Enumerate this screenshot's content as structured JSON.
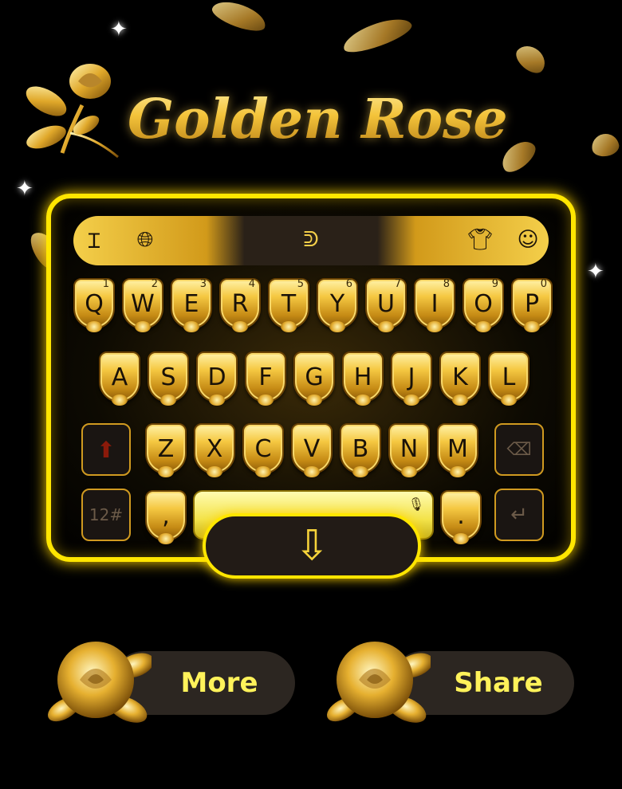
{
  "title": "Golden Rose",
  "toolbar": {
    "icons": [
      "text-cursor-icon",
      "globe-icon",
      "touchpal-logo-icon",
      "shirt-icon",
      "emoji-icon"
    ]
  },
  "keyboard": {
    "row1": [
      {
        "label": "Q",
        "num": "1"
      },
      {
        "label": "W",
        "num": "2"
      },
      {
        "label": "E",
        "num": "3"
      },
      {
        "label": "R",
        "num": "4"
      },
      {
        "label": "T",
        "num": "5"
      },
      {
        "label": "Y",
        "num": "6"
      },
      {
        "label": "U",
        "num": "7"
      },
      {
        "label": "I",
        "num": "8"
      },
      {
        "label": "O",
        "num": "9"
      },
      {
        "label": "P",
        "num": "0"
      }
    ],
    "row2": [
      "A",
      "S",
      "D",
      "F",
      "G",
      "H",
      "J",
      "K",
      "L"
    ],
    "row3": [
      "Z",
      "X",
      "C",
      "V",
      "B",
      "N",
      "M"
    ],
    "symbols_label": "12#",
    "comma_label": ",",
    "period_label": "."
  },
  "buttons": {
    "more_label": "More",
    "share_label": "Share"
  },
  "colors": {
    "accent": "#ffe600",
    "gold": "#f3c33a",
    "dark": "#2c2621",
    "button_text": "#fff25a"
  }
}
